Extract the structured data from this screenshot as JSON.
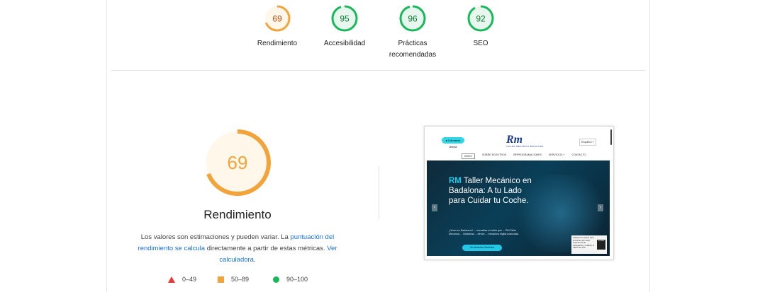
{
  "gauges": [
    {
      "score": "69",
      "value": 69,
      "label": "Rendimiento",
      "color": "#f2a33a",
      "fill": "#fff7ea",
      "text_color": "#c0490d"
    },
    {
      "score": "95",
      "value": 95,
      "label": "Accesibilidad",
      "color": "#18b85a",
      "fill": "#e8f7ee",
      "text_color": "#0a7a39"
    },
    {
      "score": "96",
      "value": 96,
      "label": "Prácticas recomendadas",
      "color": "#18b85a",
      "fill": "#e8f7ee",
      "text_color": "#0a7a39"
    },
    {
      "score": "92",
      "value": 92,
      "label": "SEO",
      "color": "#18b85a",
      "fill": "#e8f7ee",
      "text_color": "#0a7a39"
    }
  ],
  "main": {
    "score": "69",
    "value": 69,
    "title": "Rendimiento",
    "color": "#f2a33a",
    "fill": "#fff7ea",
    "desc_1": "Los valores son estimaciones y pueden variar. La ",
    "desc_link_1": "puntuación del rendimiento se calcula",
    "desc_2": " directamente a partir de estas métricas. ",
    "desc_link_2": "Ver calculadora",
    "desc_3": "."
  },
  "legend": [
    {
      "range": "0–49",
      "shape": "triangle",
      "color": "#e53935"
    },
    {
      "range": "50–89",
      "shape": "square",
      "color": "#f2a33a"
    },
    {
      "range": "90–100",
      "shape": "circle",
      "color": "#18b85a"
    }
  ],
  "screenshot": {
    "pill": "● Llámanos Ahora",
    "logo": "Rm",
    "logo_sub": "TALLER MECÁNICO BADALONA",
    "lang": "Español ˅",
    "nav": [
      "INICIO",
      "SOBRE NOSOTROS",
      "REPROGRAMACIONES",
      "SERVICIOS ˅",
      "CONTACTO"
    ],
    "hero_rm": "RM",
    "hero_title": " Taller Mecánico en Badalona: A tu Lado para Cuidar tu Coche.",
    "hero_sub": "¿Vives en Badalona? ... necesitas un taller que ... RM Taller Mecánico ... Badalona ... ofrece ... mecánica digital avanzada.",
    "hero_button": "Ver Nuestros Servicios",
    "cookie_text": "Utilizamos cookies para ofrecerte una mejor experiencia de navegación y analizar el tráfico del sitio.",
    "cookie_button": "Aceptar"
  }
}
